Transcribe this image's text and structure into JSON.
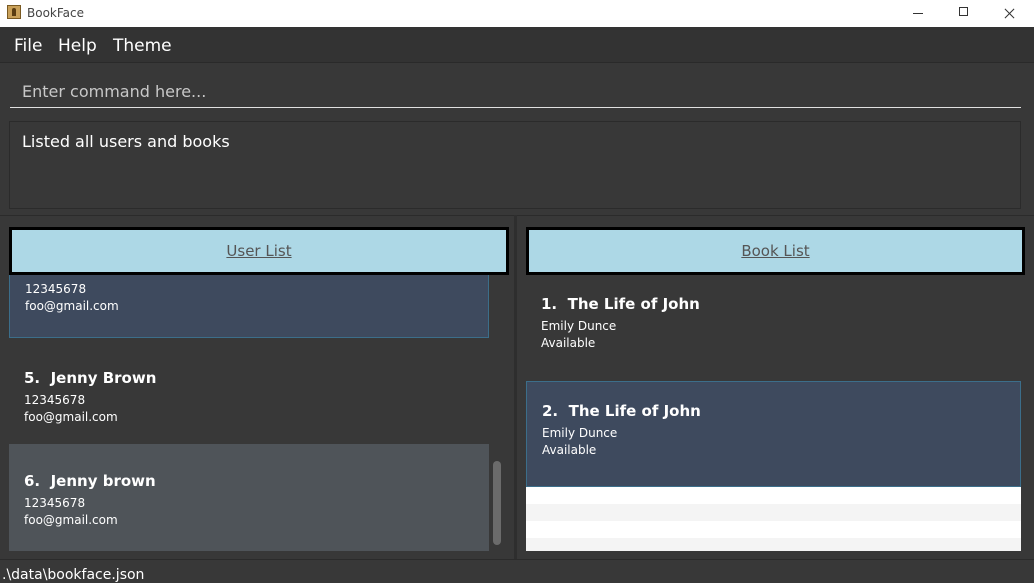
{
  "window": {
    "title": "BookFace"
  },
  "menu": {
    "file": "File",
    "help": "Help",
    "theme": "Theme"
  },
  "command": {
    "placeholder": "Enter command here...",
    "value": ""
  },
  "result": {
    "message": "Listed all users and books"
  },
  "users": {
    "header": "User List",
    "partial": {
      "phone": "12345678",
      "email": "foo@gmail.com"
    },
    "items": [
      {
        "index": "5.",
        "name": "Jenny Brown",
        "phone": "12345678",
        "email": "foo@gmail.com"
      },
      {
        "index": "6.",
        "name": "Jenny brown",
        "phone": "12345678",
        "email": "foo@gmail.com"
      }
    ]
  },
  "books": {
    "header": "Book List",
    "items": [
      {
        "index": "1.",
        "title": "The Life of John",
        "author": "Emily Dunce",
        "status": "Available"
      },
      {
        "index": "2.",
        "title": "The  Life of John",
        "author": "Emily Dunce",
        "status": "Available"
      }
    ]
  },
  "status": {
    "path": ".\\data\\bookface.json"
  },
  "colors": {
    "header_bg": "#add8e6",
    "selected_bg": "#3e4a5e",
    "hover_bg": "#4f5459",
    "app_bg": "#383838"
  }
}
